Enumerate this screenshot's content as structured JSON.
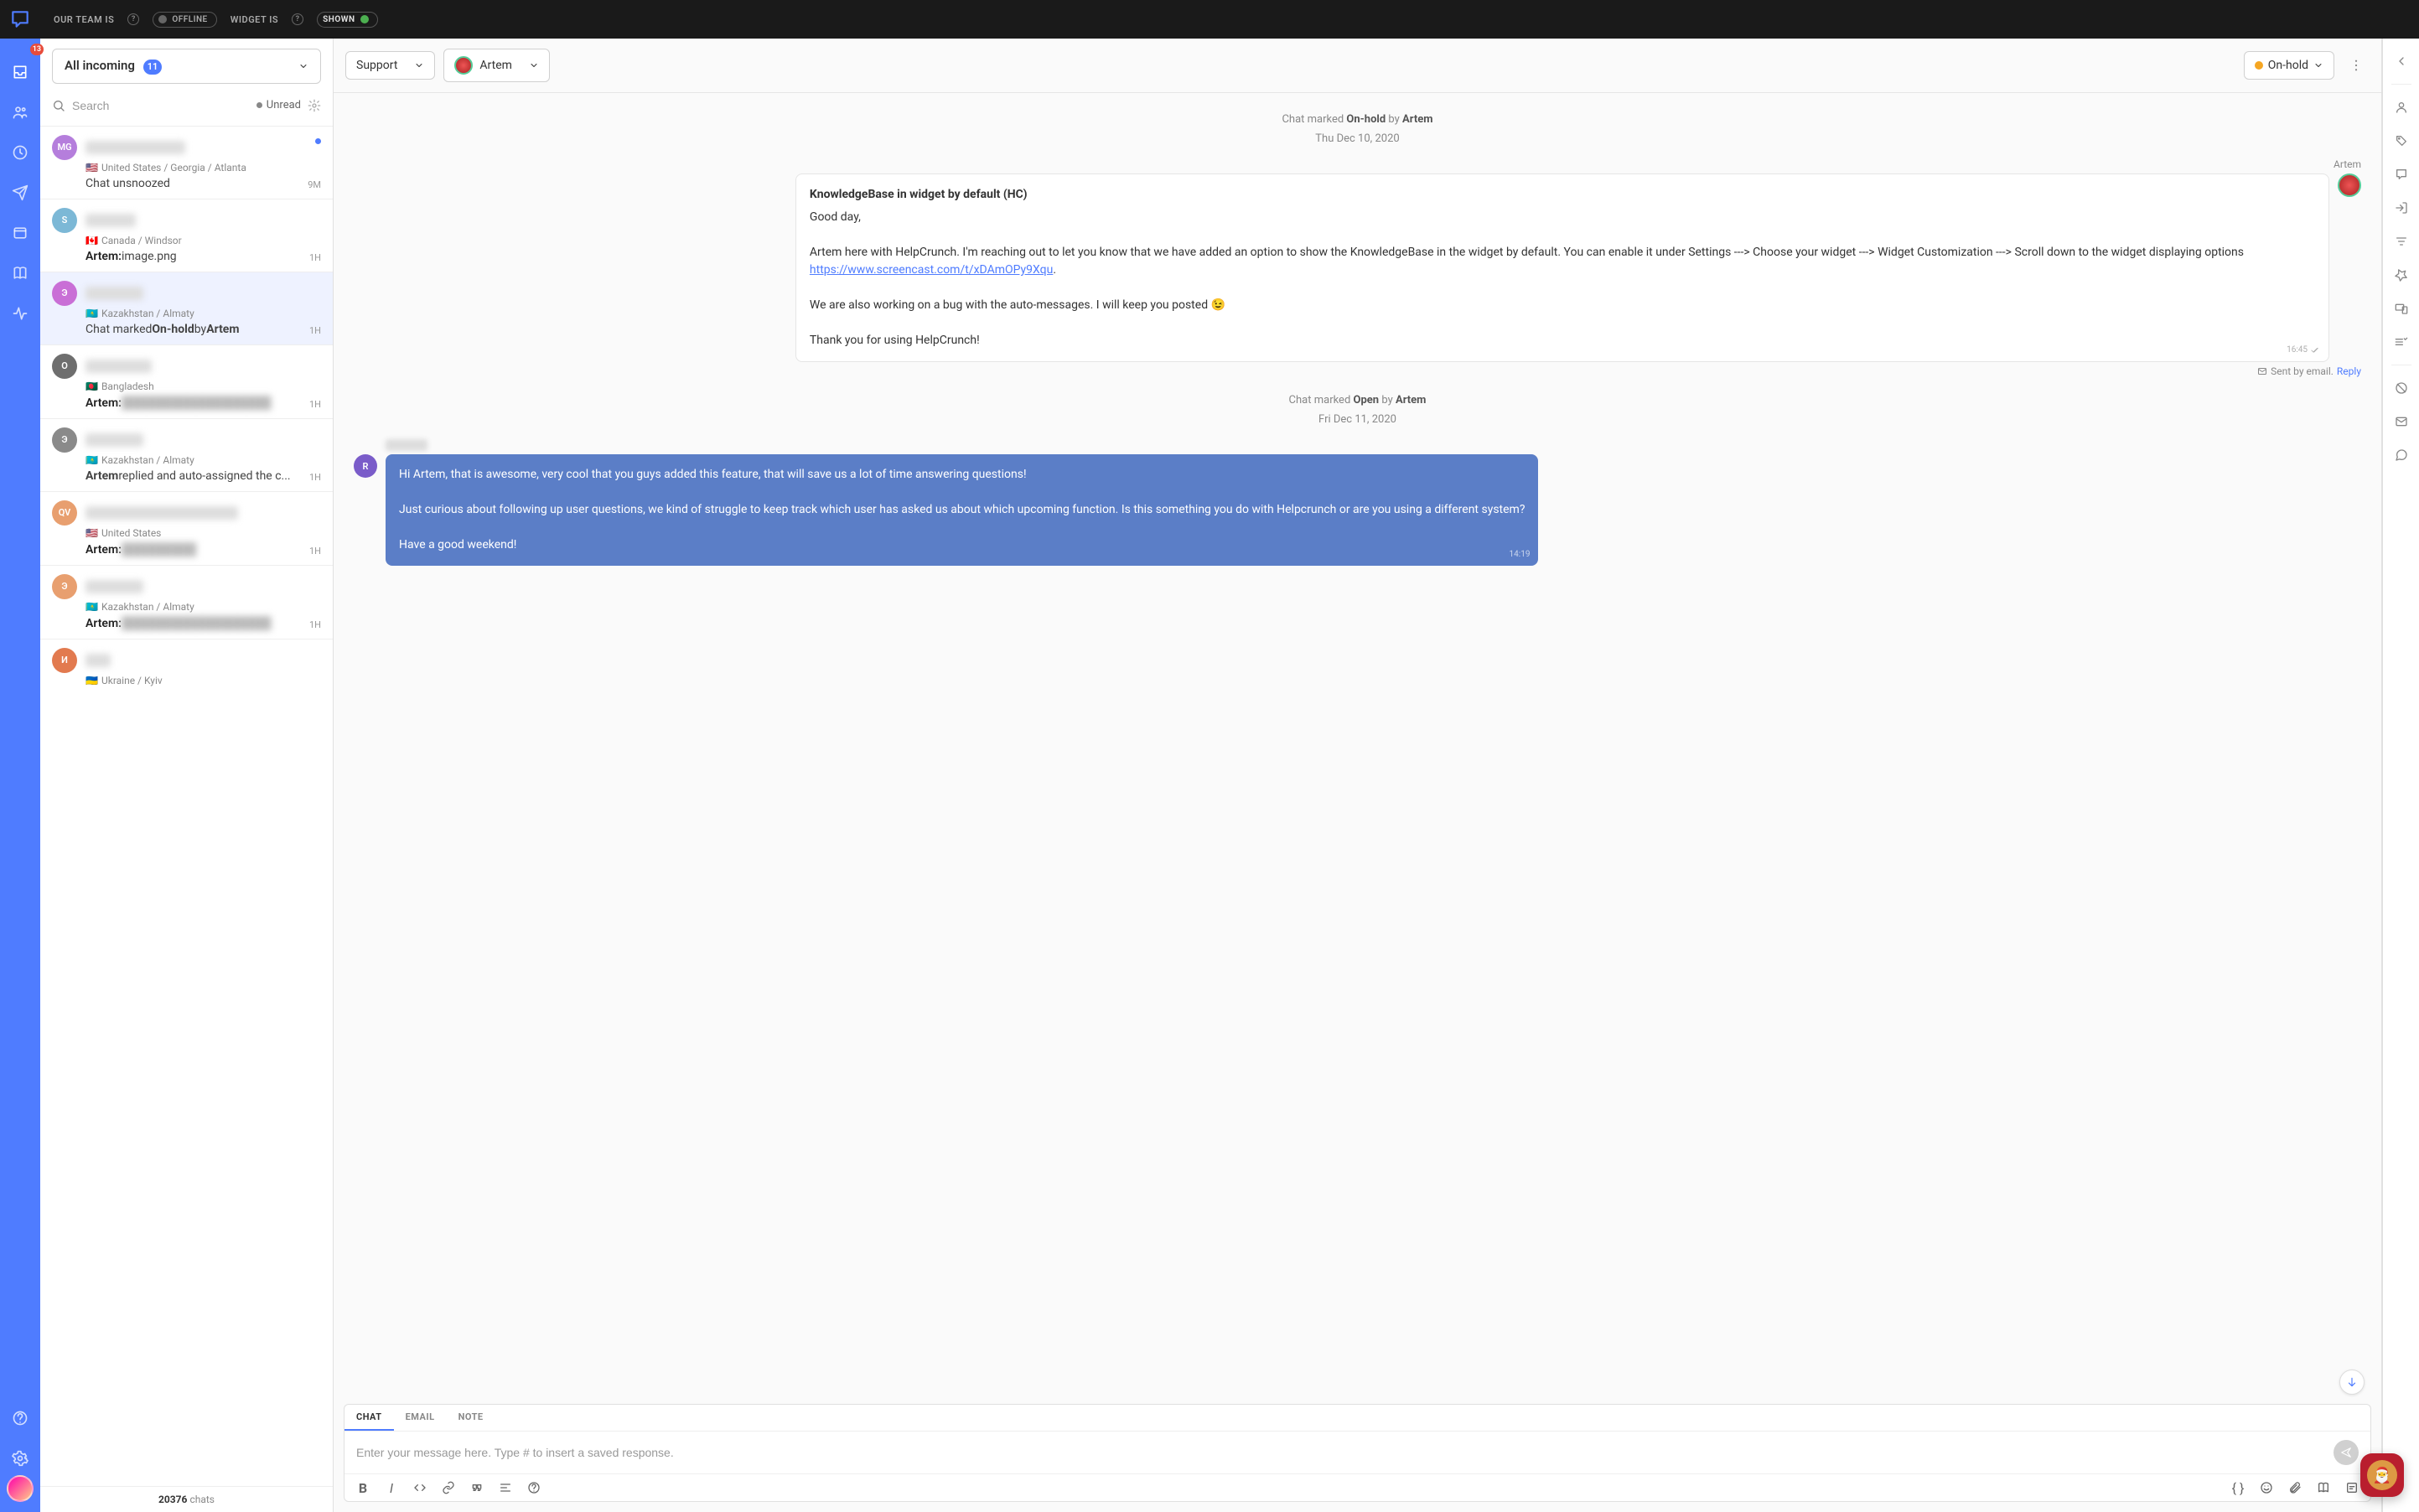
{
  "topbar": {
    "team_label": "OUR TEAM IS",
    "team_status": "OFFLINE",
    "widget_label": "WIDGET IS",
    "widget_status": "SHOWN"
  },
  "nav": {
    "inbox_badge": "13"
  },
  "convo_header": {
    "filter_label": "All incoming",
    "count": "11",
    "search_placeholder": "Search",
    "unread_label": "Unread"
  },
  "conversations": [
    {
      "initials": "MG",
      "color": "#b57edc",
      "name_blur": "████████████",
      "flag": "🇺🇸",
      "loc": "United States / Georgia / Atlanta",
      "preview_author": "",
      "preview_text": "Chat unsnoozed",
      "time": "9M",
      "dot": true
    },
    {
      "initials": "S",
      "color": "#7cb8d6",
      "name_blur": "██████",
      "flag": "🇨🇦",
      "loc": "Canada / Windsor",
      "preview_author": "Artem:",
      "preview_text": " image.png",
      "time": "1H",
      "dot": false
    },
    {
      "initials": "Э",
      "color": "#c96fd6",
      "name_blur": "███████",
      "flag": "🇰🇿",
      "loc": "Kazakhstan / Almaty",
      "preview_author": "",
      "preview_html": "Chat marked <b>On-hold</b> by <b>Artem</b>",
      "time": "1H",
      "dot": false
    },
    {
      "initials": "O",
      "color": "#6e6e6e",
      "name_blur": "████████",
      "flag": "🇧🇩",
      "loc": "Bangladesh",
      "preview_author": "Artem:",
      "preview_text_blur": "██████████████████",
      "time": "1H",
      "dot": false
    },
    {
      "initials": "Э",
      "color": "#8a8a8a",
      "name_blur": "███████",
      "flag": "🇰🇿",
      "loc": "Kazakhstan / Almaty",
      "preview_author": "",
      "preview_html": "<b>Artem</b> replied and auto-assigned the c...",
      "time": "1H",
      "dot": false
    },
    {
      "initials": "QV",
      "color": "#e89f6f",
      "name_blur": "██████████ ████████",
      "flag": "🇺🇸",
      "loc": "United States",
      "preview_author": "Artem:",
      "preview_text_blur": "█████████",
      "time": "1H",
      "dot": false
    },
    {
      "initials": "Э",
      "color": "#e89f6f",
      "name_blur": "███████",
      "flag": "🇰🇿",
      "loc": "Kazakhstan / Almaty",
      "preview_author": "Artem:",
      "preview_text_blur": "██████████████████",
      "time": "1H",
      "dot": false
    },
    {
      "initials": "И",
      "color": "#e27a4f",
      "name_blur": "███",
      "flag": "🇺🇦",
      "loc": "Ukraine / Kyiv",
      "preview_author": "",
      "preview_text": "",
      "time": "",
      "dot": false
    }
  ],
  "convo_footer": {
    "count": "20376",
    "label": "chats"
  },
  "chat_header": {
    "dept": "Support",
    "agent": "Artem",
    "status": "On-hold"
  },
  "chat": {
    "sys1_prefix": "Chat marked ",
    "sys1_status": "On-hold",
    "sys1_by": " by ",
    "sys1_agent": "Artem",
    "date1": "Thu Dec 10, 2020",
    "msg1_author": "Artem",
    "msg1_title": "KnowledgeBase in widget by default (HC)",
    "msg1_line1": "Good day,",
    "msg1_body": "Artem here with HelpCrunch. I'm reaching out to let you know that we have added an option to show the KnowledgeBase in the widget by default. You can enable it under Settings ---> Choose your widget ---> Widget Customization ---> Scroll down to the widget displaying options ",
    "msg1_link": "https://www.screencast.com/t/xDAmOPy9Xqu",
    "msg1_body2": "We are also working on a bug with the auto-messages. I will keep you posted 😉",
    "msg1_body3": "Thank you for using HelpCrunch!",
    "msg1_time": "16:45",
    "msg1_meta": "Sent by email.",
    "msg1_reply": "Reply",
    "sys2_prefix": "Chat marked ",
    "sys2_status": "Open",
    "sys2_by": " by ",
    "sys2_agent": "Artem",
    "date2": "Fri Dec 11, 2020",
    "msg2_author_blur": "████",
    "msg2_body": "Hi Artem, that is awesome, very cool that you guys added this feature, that will save us a lot of time answering questions!\n\nJust curious about following up user questions, we kind of struggle to keep track which user has asked us about which upcoming function. Is this something you do with Helpcrunch or are you using a different system?\n\nHave a good weekend!",
    "msg2_time": "14:19"
  },
  "composer": {
    "tab_chat": "CHAT",
    "tab_email": "EMAIL",
    "tab_note": "NOTE",
    "placeholder": "Enter your message here. Type # to insert a saved response."
  }
}
